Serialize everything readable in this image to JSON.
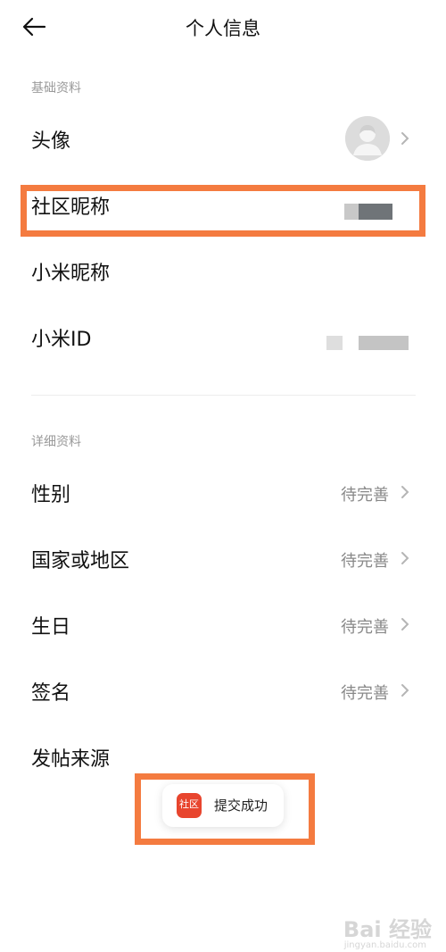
{
  "header": {
    "title": "个人信息",
    "back_icon": "arrow-left-icon"
  },
  "sections": {
    "basic": {
      "label": "基础资料",
      "rows": [
        {
          "label": "头像"
        },
        {
          "label": "社区昵称"
        },
        {
          "label": "小米昵称"
        },
        {
          "label": "小米ID"
        }
      ]
    },
    "detail": {
      "label": "详细资料",
      "rows": [
        {
          "label": "性别",
          "value": "待完善"
        },
        {
          "label": "国家或地区",
          "value": "待完善"
        },
        {
          "label": "生日",
          "value": "待完善"
        },
        {
          "label": "签名",
          "value": "待完善"
        },
        {
          "label": "发帖来源"
        }
      ]
    }
  },
  "toast": {
    "icon_text": "社区",
    "message": "提交成功"
  },
  "watermark": {
    "text": "Bai 经验",
    "sub": "jingyan.baidu.com"
  },
  "colors": {
    "highlight": "#f47b40",
    "toast_icon": "#e8452e"
  }
}
